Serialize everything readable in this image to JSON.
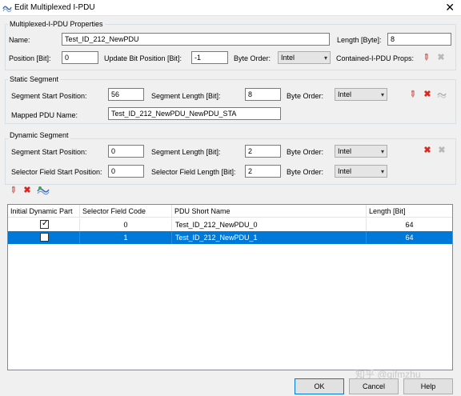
{
  "window": {
    "title": "Edit Multiplexed I-PDU",
    "close_label": "✕"
  },
  "properties": {
    "group_label": "Multiplexed-I-PDU Properties",
    "name_label": "Name:",
    "name_value": "Test_ID_212_NewPDU",
    "length_label": "Length [Byte]:",
    "length_value": "8",
    "position_label": "Position [Bit]:",
    "position_value": "0",
    "update_bit_label": "Update Bit Position [Bit]:",
    "update_bit_value": "-1",
    "byte_order_label": "Byte Order:",
    "byte_order_value": "Intel",
    "contained_label": "Contained-I-PDU Props:"
  },
  "static_segment": {
    "group_label": "Static Segment",
    "start_label": "Segment Start Position:",
    "start_value": "56",
    "length_label": "Segment Length [Bit]:",
    "length_value": "8",
    "byte_order_label": "Byte Order:",
    "byte_order_value": "Intel",
    "mapped_label": "Mapped PDU Name:",
    "mapped_value": "Test_ID_212_NewPDU_NewPDU_STA"
  },
  "dynamic_segment": {
    "group_label": "Dynamic Segment",
    "start_label": "Segment Start Position:",
    "start_value": "0",
    "length_label": "Segment Length [Bit]:",
    "length_value": "2",
    "byte_order_label": "Byte Order:",
    "byte_order_value": "Intel",
    "selector_start_label": "Selector Field Start Position:",
    "selector_start_value": "0",
    "selector_length_label": "Selector Field Length [Bit]:",
    "selector_length_value": "2",
    "selector_byte_order_label": "Byte Order:",
    "selector_byte_order_value": "Intel"
  },
  "table": {
    "columns": [
      "Initial Dynamic Part",
      "Selector Field Code",
      "PDU Short Name",
      "Length [Bit]"
    ],
    "rows": [
      {
        "initial": true,
        "code": "0",
        "name": "Test_ID_212_NewPDU_0",
        "length": "64",
        "selected": false
      },
      {
        "initial": false,
        "code": "1",
        "name": "Test_ID_212_NewPDU_1",
        "length": "64",
        "selected": true
      }
    ]
  },
  "buttons": {
    "ok": "OK",
    "cancel": "Cancel",
    "help": "Help"
  },
  "watermark": "知乎 @qifmzhu",
  "icons": {
    "edit": "pencil-icon",
    "delete": "delete-x-icon",
    "add": "add-pdu-icon",
    "accent_red": "#d9281f",
    "selection_blue": "#0078d7"
  }
}
